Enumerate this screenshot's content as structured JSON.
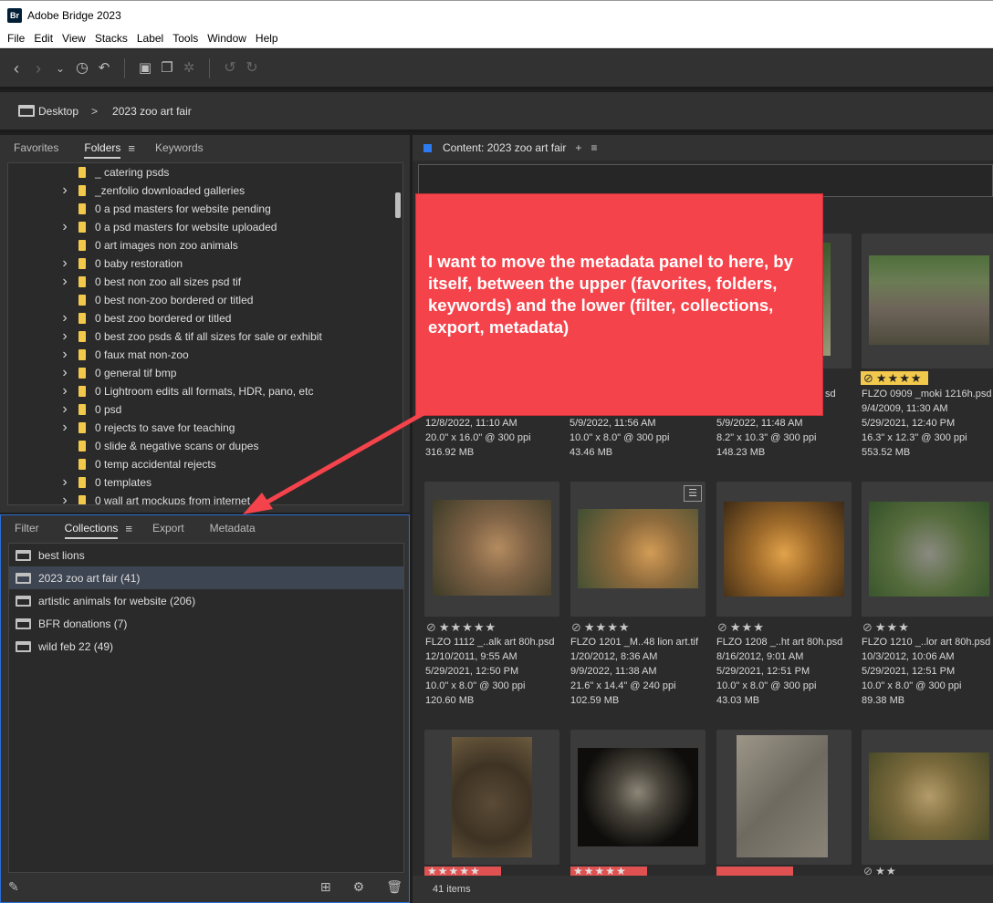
{
  "window": {
    "badge": "Br",
    "title": "Adobe Bridge 2023"
  },
  "menu": [
    "File",
    "Edit",
    "View",
    "Stacks",
    "Label",
    "Tools",
    "Window",
    "Help"
  ],
  "path": {
    "root": "Desktop",
    "separator": ">",
    "current": "2023 zoo art fair"
  },
  "top_panel": {
    "tabs": [
      "Favorites",
      "Folders",
      "Keywords"
    ],
    "active_tab": "Folders",
    "folders": [
      {
        "name": "_ catering psds",
        "expandable": false
      },
      {
        "name": "_zenfolio downloaded galleries",
        "expandable": true
      },
      {
        "name": "0 a psd masters for website pending",
        "expandable": false
      },
      {
        "name": "0 a psd masters for website uploaded",
        "expandable": true
      },
      {
        "name": "0 art images non zoo animals",
        "expandable": false
      },
      {
        "name": "0 baby restoration",
        "expandable": true
      },
      {
        "name": "0 best non zoo all sizes psd tif",
        "expandable": true
      },
      {
        "name": "0 best non-zoo bordered or titled",
        "expandable": false
      },
      {
        "name": "0 best zoo bordered or titled",
        "expandable": true
      },
      {
        "name": "0 best zoo psds & tif all sizes for sale or exhibit",
        "expandable": true
      },
      {
        "name": "0 faux mat non-zoo",
        "expandable": true
      },
      {
        "name": "0 general tif bmp",
        "expandable": true
      },
      {
        "name": "0 Lightroom edits all formats, HDR, pano, etc",
        "expandable": true
      },
      {
        "name": "0 psd",
        "expandable": true
      },
      {
        "name": "0 rejects to save for teaching",
        "expandable": true
      },
      {
        "name": "0 slide & negative scans or dupes",
        "expandable": false
      },
      {
        "name": "0 temp accidental rejects",
        "expandable": false
      },
      {
        "name": "0 templates",
        "expandable": true
      },
      {
        "name": "0 wall art mockups from internet",
        "expandable": true
      }
    ]
  },
  "bottom_panel": {
    "tabs": [
      "Filter",
      "Collections",
      "Export",
      "Metadata"
    ],
    "active_tab": "Collections",
    "collections": [
      {
        "name": "best lions",
        "selected": false
      },
      {
        "name": "2023 zoo art fair (41)",
        "selected": true
      },
      {
        "name": "artistic animals for website (206)",
        "selected": false
      },
      {
        "name": "BFR donations (7)",
        "selected": false
      },
      {
        "name": "wild feb 22 (49)",
        "selected": false
      }
    ]
  },
  "content": {
    "title": "Content: 2023 zoo art fair",
    "items_count": "41 items",
    "row1": [
      {
        "lines": [
          "12/8/2022, 11:10 AM",
          "20.0\" x 16.0\" @ 300 ppi",
          "316.92 MB"
        ]
      },
      {
        "lines": [
          "5/9/2022, 11:56 AM",
          "10.0\" x 8.0\" @ 300 ppi",
          "43.46 MB"
        ]
      },
      {
        "filename_tail": "sd",
        "lines": [
          "5/9/2022, 11:48 AM",
          "8.2\" x 10.3\" @ 300 ppi",
          "148.23 MB"
        ]
      },
      {
        "stars": "★★★★",
        "filename": "FLZO 0909 _moki 1216h.psd",
        "lines": [
          "9/4/2009, 11:30 AM",
          "5/29/2021, 12:40 PM",
          "16.3\" x 12.3\" @ 300 ppi",
          "553.52 MB"
        ]
      }
    ],
    "row2": [
      {
        "stars": "★★★★★",
        "filename": "FLZO 1112 _..alk art 80h.psd",
        "lines": [
          "12/10/2011, 9:55 AM",
          "5/29/2021, 12:50 PM",
          "10.0\" x 8.0\" @ 300 ppi",
          "120.60 MB"
        ]
      },
      {
        "stars": "★★★★",
        "filename": "FLZO 1201 _M..48 lion art.tif",
        "lines": [
          "1/20/2012, 8:36 AM",
          "9/9/2022, 11:38 AM",
          "21.6\" x 14.4\" @ 240 ppi",
          "102.59 MB"
        ]
      },
      {
        "stars": "★★★",
        "filename": "FLZO 1208 _..ht art 80h.psd",
        "lines": [
          "8/16/2012, 9:01 AM",
          "5/29/2021, 12:51 PM",
          "10.0\" x 8.0\" @ 300 ppi",
          "43.03 MB"
        ]
      },
      {
        "stars": "★★★",
        "filename": "FLZO 1210 _..lor art 80h.psd",
        "lines": [
          "10/3/2012, 10:06 AM",
          "5/29/2021, 12:51 PM",
          "10.0\" x 8.0\" @ 300 ppi",
          "89.38 MB"
        ]
      }
    ],
    "row3_stars": [
      "★★★★★",
      "★★★★★",
      "",
      "★★"
    ]
  },
  "callout": {
    "text": "I want to move the metadata panel to here,  by itself, between the upper (favorites, folders, keywords) and the lower (filter, collections, export, metadata)"
  },
  "colors": {
    "accent": "#2d7bf0",
    "callout": "#f5434b",
    "star_label": "#f2c94c",
    "red_label": "#e05252",
    "folder": "#f3c94b"
  }
}
